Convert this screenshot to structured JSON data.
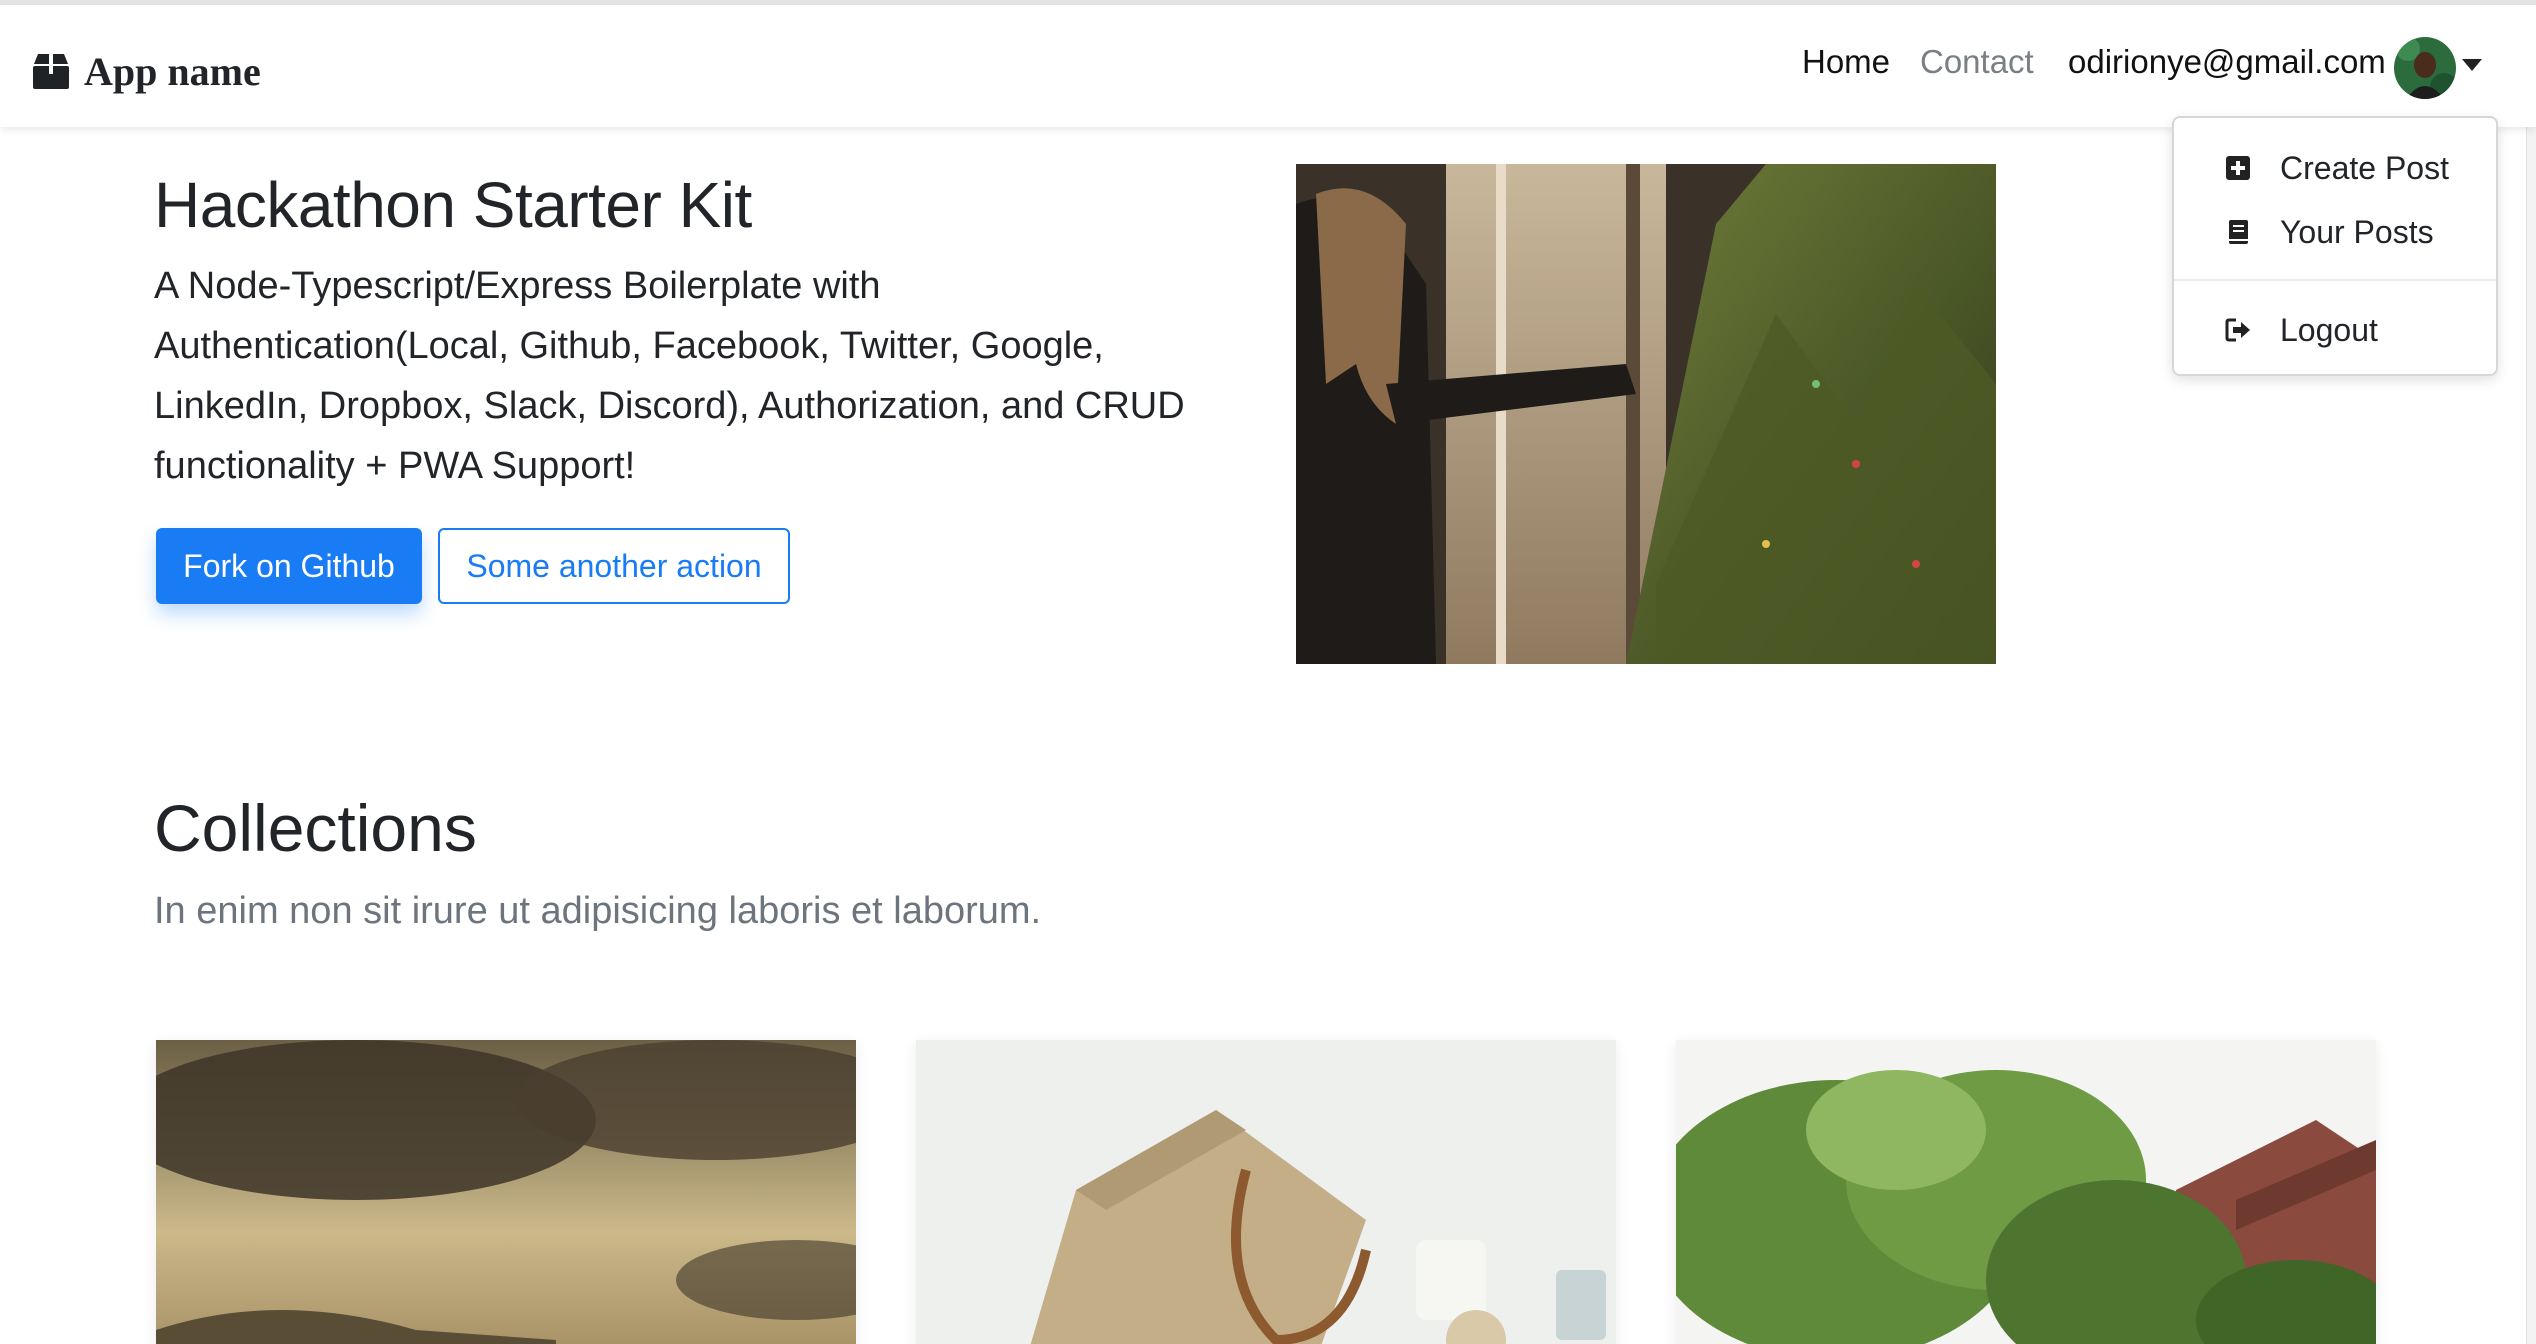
{
  "navbar": {
    "brand_icon": "box-icon",
    "brand_name": "App name",
    "links": {
      "home": "Home",
      "contact": "Contact"
    },
    "user_email": "odirionye@gmail.com",
    "avatar_icon": "user-avatar",
    "caret_icon": "caret-down-icon"
  },
  "dropdown": {
    "items": [
      {
        "label": "Create Post",
        "icon": "plus-square-icon"
      },
      {
        "label": "Your Posts",
        "icon": "book-icon"
      },
      {
        "label": "Logout",
        "icon": "sign-out-icon"
      }
    ]
  },
  "hero": {
    "title": "Hackathon Starter Kit",
    "description": "A Node-Typescript/Express Boilerplate with Authentication(Local, Github, Facebook, Twitter, Google, LinkedIn, Dropbox, Slack, Discord), Authorization, and CRUD functionality + PWA Support!",
    "primary_button": "Fork on Github",
    "secondary_button": "Some another action"
  },
  "collections": {
    "title": "Collections",
    "subtitle": "In enim non sit irure ut adipisicing laboris et laborum."
  },
  "colors": {
    "primary": "#1a7cf5",
    "text": "#212529",
    "muted": "#6c757d",
    "nav_muted": "#7a7f85"
  }
}
